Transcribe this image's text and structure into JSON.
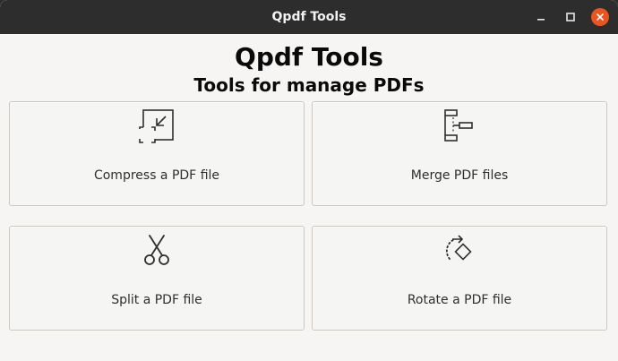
{
  "window": {
    "title": "Qpdf Tools",
    "controls": [
      "minimize-icon",
      "maximize-icon",
      "close-icon"
    ],
    "close_color": "#e95420"
  },
  "header": {
    "title": "Qpdf Tools",
    "subtitle": "Tools for manage PDFs"
  },
  "tools": [
    {
      "label": "Compress a PDF file",
      "icon": "compress-icon"
    },
    {
      "label": "Merge PDF files",
      "icon": "merge-icon"
    },
    {
      "label": "Split a PDF file",
      "icon": "scissors-icon"
    },
    {
      "label": "Rotate a PDF file",
      "icon": "rotate-icon"
    }
  ]
}
